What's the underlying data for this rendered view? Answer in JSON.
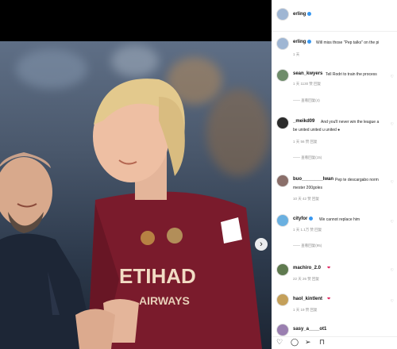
{
  "post": {
    "author": "erling",
    "next_icon": "chevron-right-icon"
  },
  "photo": {
    "sponsor_text": "ETIHAD",
    "sponsor_sub": "AIRWAYS"
  },
  "caption": {
    "user": "erling",
    "text": "Will miss those \"Pep talks\" on the pi",
    "time": "1 天"
  },
  "comments": [
    {
      "user": "sean_kwyers",
      "text": "Tell Rodri to train the process",
      "meta": "1 天   1130 赞   回复",
      "replies": "—— 查看回复(4)"
    },
    {
      "user": "_meikd09",
      "text": "And you'll never win the league a",
      "text2": "be united united u united ●",
      "meta": "1 天   56 赞   回复",
      "replies": "—— 查看回复(15)"
    },
    {
      "user": "buo________lwan",
      "text": "Pep te descargabo norm",
      "text2": "mester 200goles",
      "meta": "10 天   42 赞   回复",
      "replies": "—— 查看回复(3)"
    },
    {
      "user": "cityfor",
      "text": "We cannot replace him ",
      "meta": "1 天   1.1万 赞   回复",
      "replies": "—— 查看回复(95)"
    },
    {
      "user": "machiro_2.0",
      "text": "❤",
      "meta": "22 天   26 赞   回复"
    },
    {
      "user": "haol_kintlent",
      "text": "❤",
      "meta": "1 天   19 赞   回复"
    },
    {
      "user": "sasy_a____ot1"
    }
  ],
  "actions": {
    "like_icon": "♡",
    "comment_icon": "◯",
    "share_icon": "➢",
    "save_icon": "⊓"
  },
  "colors": {
    "verified": "#3897f0",
    "maroon_jersey": "#7a1b2c"
  }
}
